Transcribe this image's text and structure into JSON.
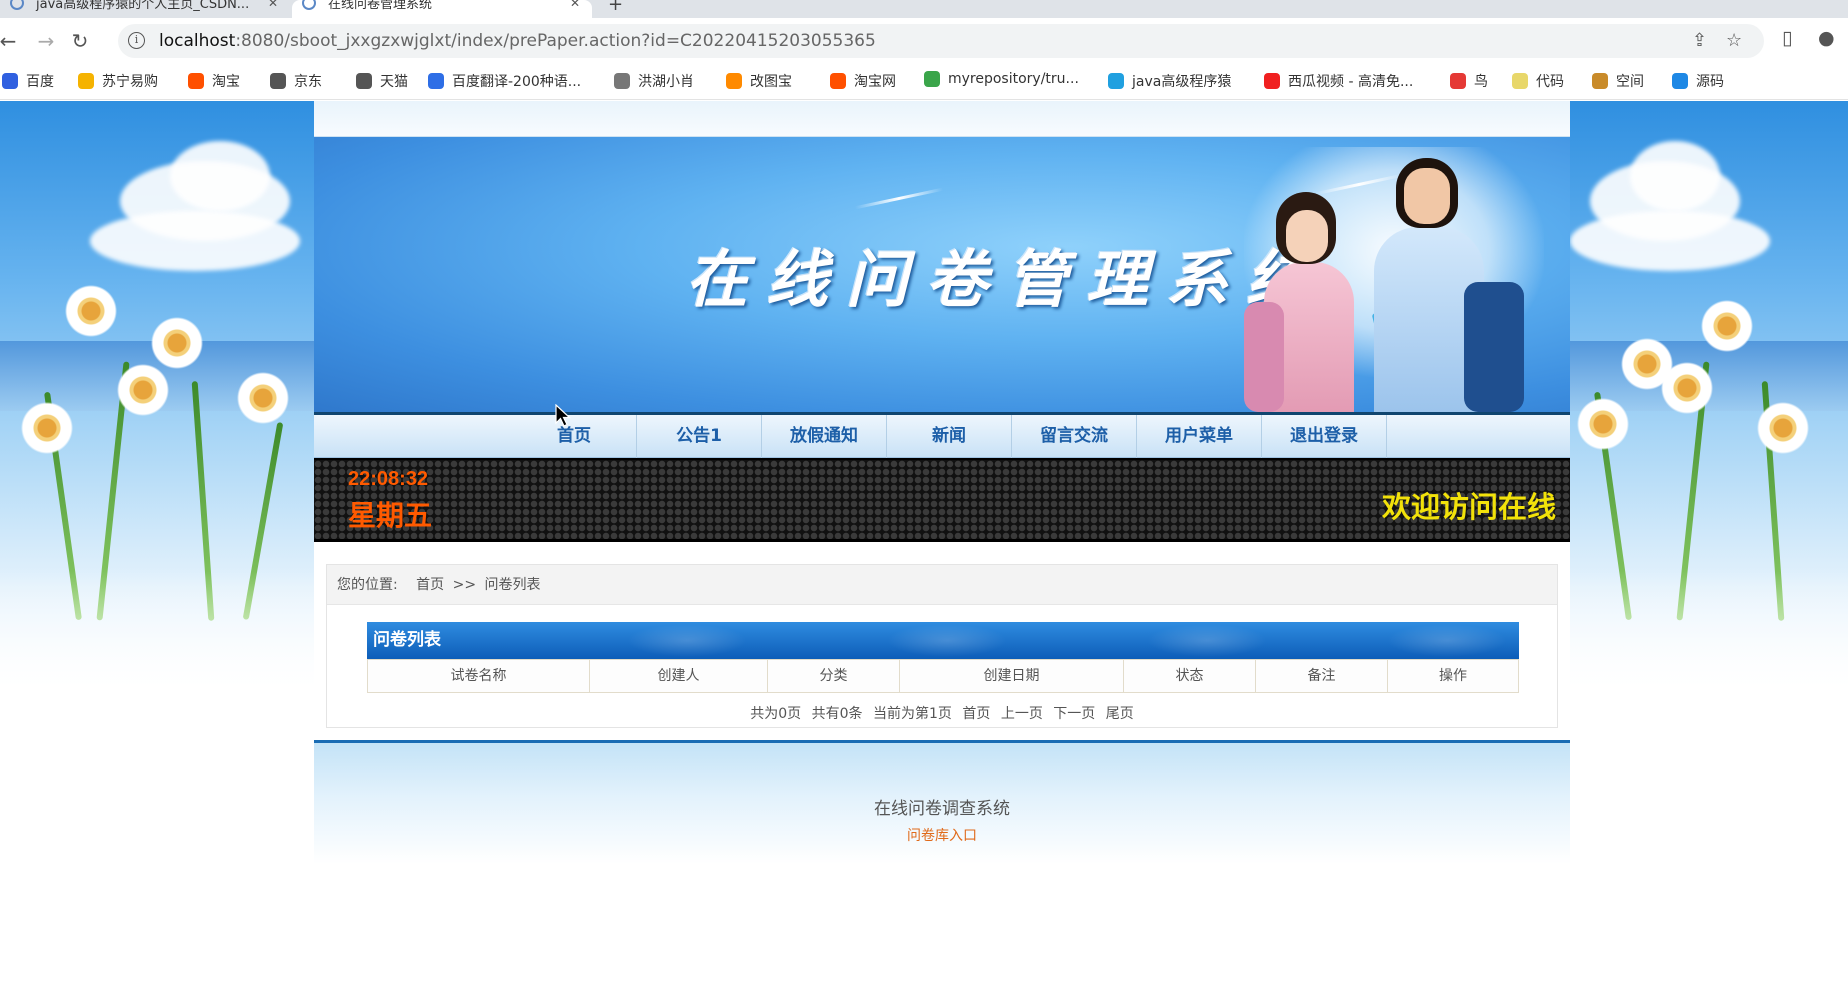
{
  "browser": {
    "tabs": [
      {
        "label": "java高级程序猿的个人主页_CSDN..."
      },
      {
        "label": "在线问卷管理系统"
      }
    ],
    "new_tab_icon": "plus-icon",
    "url_host": "localhost",
    "url_rest": ":8080/sboot_jxxgzxwjglxt/index/prePaper.action?id=C20220415203055365",
    "bookmarks": [
      {
        "label": "百度",
        "color": "#3060e0"
      },
      {
        "label": "苏宁易购",
        "color": "#f5b301"
      },
      {
        "label": "淘宝",
        "color": "#ff5000"
      },
      {
        "label": "京东",
        "color": "#555555"
      },
      {
        "label": "天猫",
        "color": "#555555"
      },
      {
        "label": "百度翻译-200种语...",
        "color": "#2e6ee6"
      },
      {
        "label": "洪湖小肖",
        "color": "#777777"
      },
      {
        "label": "改图宝",
        "color": "#ff8a00"
      },
      {
        "label": "淘宝网",
        "color": "#ff5000"
      },
      {
        "label": "myrepository/tru...",
        "color": "#3aa54a"
      },
      {
        "label": "java高级程序猿",
        "color": "#20a0e0"
      },
      {
        "label": "西瓜视频 - 高清免...",
        "color": "#f02020"
      },
      {
        "label": "鸟",
        "color": "#e53935"
      },
      {
        "label": "代码",
        "color": "#e8d76a"
      },
      {
        "label": "空间",
        "color": "#c98b2a"
      },
      {
        "label": "源码",
        "color": "#1e88e5"
      }
    ]
  },
  "site": {
    "banner_title": "在线问卷管理系统",
    "nav": [
      "首页",
      "公告1",
      "放假通知",
      "新闻",
      "留言交流",
      "用户菜单",
      "退出登录"
    ],
    "clock": "22:08:32",
    "weekday": "星期五",
    "marquee": "欢迎访问在线",
    "breadcrumb": {
      "label": "您的位置:",
      "home": "首页",
      "sep": ">>",
      "current": "问卷列表"
    },
    "panel_title": "问卷列表",
    "columns": [
      "试卷名称",
      "创建人",
      "分类",
      "创建日期",
      "状态",
      "备注",
      "操作"
    ],
    "pager": {
      "total_pages": "共为0页",
      "total_items": "共有0条",
      "current": "当前为第1页",
      "first": "首页",
      "prev": "上一页",
      "next": "下一页",
      "last": "尾页"
    },
    "footer_title": "在线问卷调查系统",
    "footer_link": "问卷库入口"
  }
}
